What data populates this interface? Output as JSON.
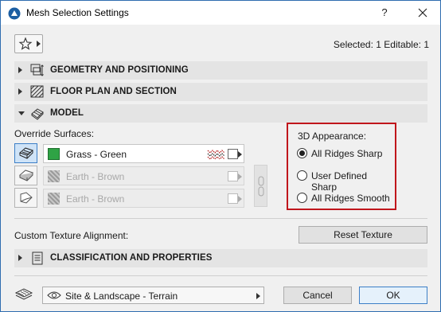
{
  "window": {
    "title": "Mesh Selection Settings",
    "help_label": "?"
  },
  "header": {
    "selected_info": "Selected: 1 Editable: 1"
  },
  "sections": {
    "geometry": "GEOMETRY AND POSITIONING",
    "floor_plan": "FLOOR PLAN AND SECTION",
    "model": "MODEL",
    "classification": "CLASSIFICATION AND PROPERTIES"
  },
  "model": {
    "override_label": "Override Surfaces:",
    "surfaces": [
      {
        "name": "Grass - Green",
        "enabled": true,
        "color": "#2fa345"
      },
      {
        "name": "Earth - Brown",
        "enabled": false
      },
      {
        "name": "Earth - Brown",
        "enabled": false
      }
    ],
    "appearance": {
      "title": "3D Appearance:",
      "options": [
        "All Ridges Sharp",
        "User Defined Sharp",
        "All Ridges Smooth"
      ],
      "selected": "All Ridges Sharp"
    },
    "texture_label": "Custom Texture Alignment:",
    "reset_texture_label": "Reset Texture"
  },
  "footer": {
    "layer_value": "Site & Landscape - Terrain",
    "cancel_label": "Cancel",
    "ok_label": "OK"
  },
  "colors": {
    "accent": "#3c7fc7",
    "highlight_border": "#c0161c"
  }
}
